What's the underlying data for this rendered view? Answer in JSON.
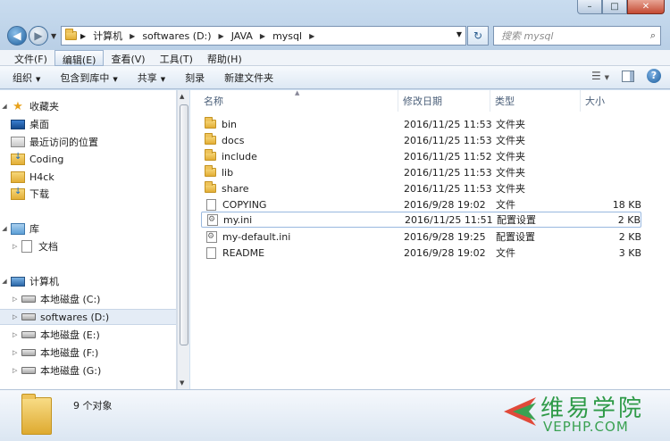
{
  "window": {
    "controls": {
      "minimize": "–",
      "maximize": "□",
      "close": "✕"
    }
  },
  "address": {
    "crumbs": [
      "计算机",
      "softwares (D:)",
      "JAVA",
      "mysql"
    ],
    "search_placeholder": "搜索 mysql"
  },
  "menu": [
    "文件(F)",
    "编辑(E)",
    "查看(V)",
    "工具(T)",
    "帮助(H)"
  ],
  "toolbar": [
    "组织",
    "包含到库中",
    "共享",
    "刻录",
    "新建文件夹"
  ],
  "nav": {
    "favorites": {
      "label": "收藏夹",
      "items": [
        "桌面",
        "最近访问的位置",
        "Coding",
        "H4ck",
        "下载"
      ]
    },
    "libraries": {
      "label": "库",
      "items": [
        "文档"
      ]
    },
    "computer": {
      "label": "计算机",
      "items": [
        "本地磁盘 (C:)",
        "softwares (D:)",
        "本地磁盘 (E:)",
        "本地磁盘 (F:)",
        "本地磁盘 (G:)"
      ]
    }
  },
  "columns": {
    "name": "名称",
    "date": "修改日期",
    "type": "类型",
    "size": "大小"
  },
  "files": [
    {
      "name": "bin",
      "date": "2016/11/25 11:53",
      "type": "文件夹",
      "size": "",
      "icon": "folder-icon"
    },
    {
      "name": "docs",
      "date": "2016/11/25 11:53",
      "type": "文件夹",
      "size": "",
      "icon": "folder-icon"
    },
    {
      "name": "include",
      "date": "2016/11/25 11:52",
      "type": "文件夹",
      "size": "",
      "icon": "folder-icon"
    },
    {
      "name": "lib",
      "date": "2016/11/25 11:53",
      "type": "文件夹",
      "size": "",
      "icon": "folder-icon"
    },
    {
      "name": "share",
      "date": "2016/11/25 11:53",
      "type": "文件夹",
      "size": "",
      "icon": "folder-icon"
    },
    {
      "name": "COPYING",
      "date": "2016/9/28 19:02",
      "type": "文件",
      "size": "18 KB",
      "icon": "file-icon"
    },
    {
      "name": "my.ini",
      "date": "2016/11/25 11:51",
      "type": "配置设置",
      "size": "2 KB",
      "icon": "ini-file-icon"
    },
    {
      "name": "my-default.ini",
      "date": "2016/9/28 19:25",
      "type": "配置设置",
      "size": "2 KB",
      "icon": "ini-file-icon"
    },
    {
      "name": "README",
      "date": "2016/9/28 19:02",
      "type": "文件",
      "size": "3 KB",
      "icon": "file-icon"
    }
  ],
  "status": {
    "count": "9 个对象"
  },
  "watermark": {
    "cn": "维易学院",
    "en": "VEPHP.COM"
  },
  "colors": {
    "accent": "#1d5e9c",
    "watermark": "#2e9a47"
  }
}
